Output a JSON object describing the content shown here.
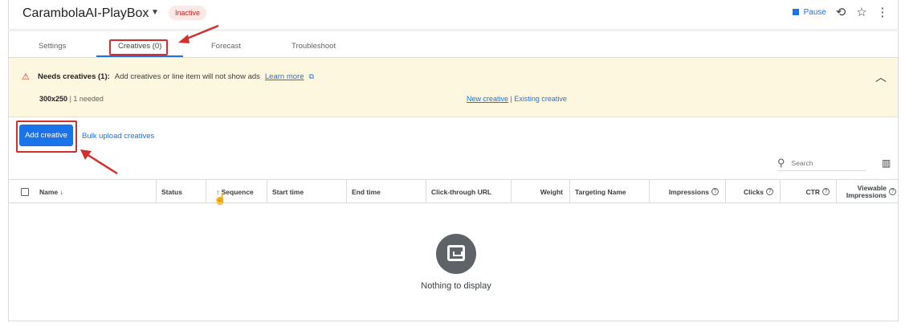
{
  "header": {
    "title": "CarambolaAI-PlayBox",
    "status_badge": "Inactive",
    "pause_label": "Pause",
    "icons": [
      "pause-square-icon",
      "history-icon",
      "star-icon",
      "more-vert-icon"
    ]
  },
  "tabs": [
    {
      "label": "Settings",
      "active": false
    },
    {
      "label": "Creatives (0)",
      "active": true
    },
    {
      "label": "Forecast",
      "active": false
    },
    {
      "label": "Troubleshoot",
      "active": false
    }
  ],
  "alert": {
    "title": "Needs creatives (1):",
    "message": "Add creatives or line item will not show ads",
    "learn_more": "Learn more",
    "size": "300x250",
    "needed": "| 1 needed",
    "new_creative": "New creative",
    "separator": "|",
    "existing_creative": "Existing creative"
  },
  "actions": {
    "add_creative": "Add creative",
    "bulk_upload": "Bulk upload creatives"
  },
  "search": {
    "placeholder": "Search"
  },
  "table": {
    "columns": [
      {
        "label": "Name",
        "sort": "↓"
      },
      {
        "label": "Status"
      },
      {
        "label": "Sequence",
        "sort": "↑"
      },
      {
        "label": "Start time"
      },
      {
        "label": "End time"
      },
      {
        "label": "Click-through URL"
      },
      {
        "label": "Weight"
      },
      {
        "label": "Targeting Name"
      },
      {
        "label": "Impressions"
      },
      {
        "label": "Clicks"
      },
      {
        "label": "CTR"
      },
      {
        "label": "Viewable Impressions"
      }
    ],
    "empty_message": "Nothing to display"
  },
  "colors": {
    "accent": "#1a73e8",
    "alert_bg": "#fef7e0",
    "badge_bg": "#fce8e6",
    "badge_text": "#c5221f",
    "annotation_red": "#d32f2f"
  }
}
